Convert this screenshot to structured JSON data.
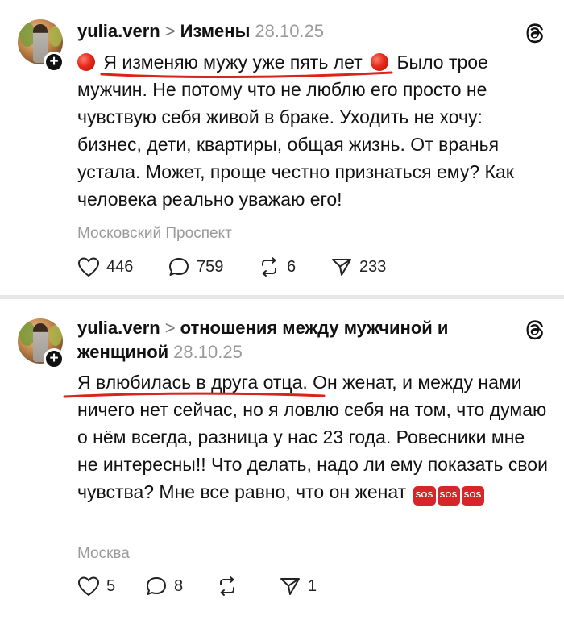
{
  "posts": [
    {
      "username": "yulia.vern",
      "chevron": ">",
      "topic": "Измены",
      "date": "28.10.25",
      "text": {
        "highlight": "Я изменяю мужу уже пять лет",
        "line1_tail": "Было трое",
        "rest": "мужчин. Не потому что не люблю его просто не чувствую себя живой в браке. Уходить не хочу: бизнес, дети, квартиры, общая жизнь. От вранья устала. Может, проще честно признаться ему? Как человека реально уважаю его!"
      },
      "location": "Московский Проспект",
      "counts": {
        "likes": "446",
        "replies": "759",
        "reposts": "6",
        "shares": "233"
      }
    },
    {
      "username": "yulia.vern",
      "chevron": ">",
      "topic": "отношения между мужчиной и женщиной",
      "date": "28.10.25",
      "text": {
        "highlight": "Я влюбилась в друга отца",
        "rest": ". Он женат, и между нами ничего нет сейчас, но я ловлю себя на том, что думаю о нём всегда, разница у нас 23 года. Ровесники мне не интересны!! Что делать, надо ли ему показать свои чувства? Мне все равно, что он женат",
        "emoji_label": "SOS"
      },
      "location": "Москва",
      "counts": {
        "likes": "5",
        "replies": "8",
        "reposts": "",
        "shares": "1"
      }
    }
  ],
  "colors": {
    "highlight_underline": "#d9231c",
    "muted": "#9a9a9a",
    "sos": "#d7262a"
  },
  "icons": [
    "threads-logo-icon",
    "heart-icon",
    "comment-icon",
    "repost-icon",
    "share-icon",
    "plus-icon",
    "red-circle-emoji",
    "sos-emoji"
  ]
}
